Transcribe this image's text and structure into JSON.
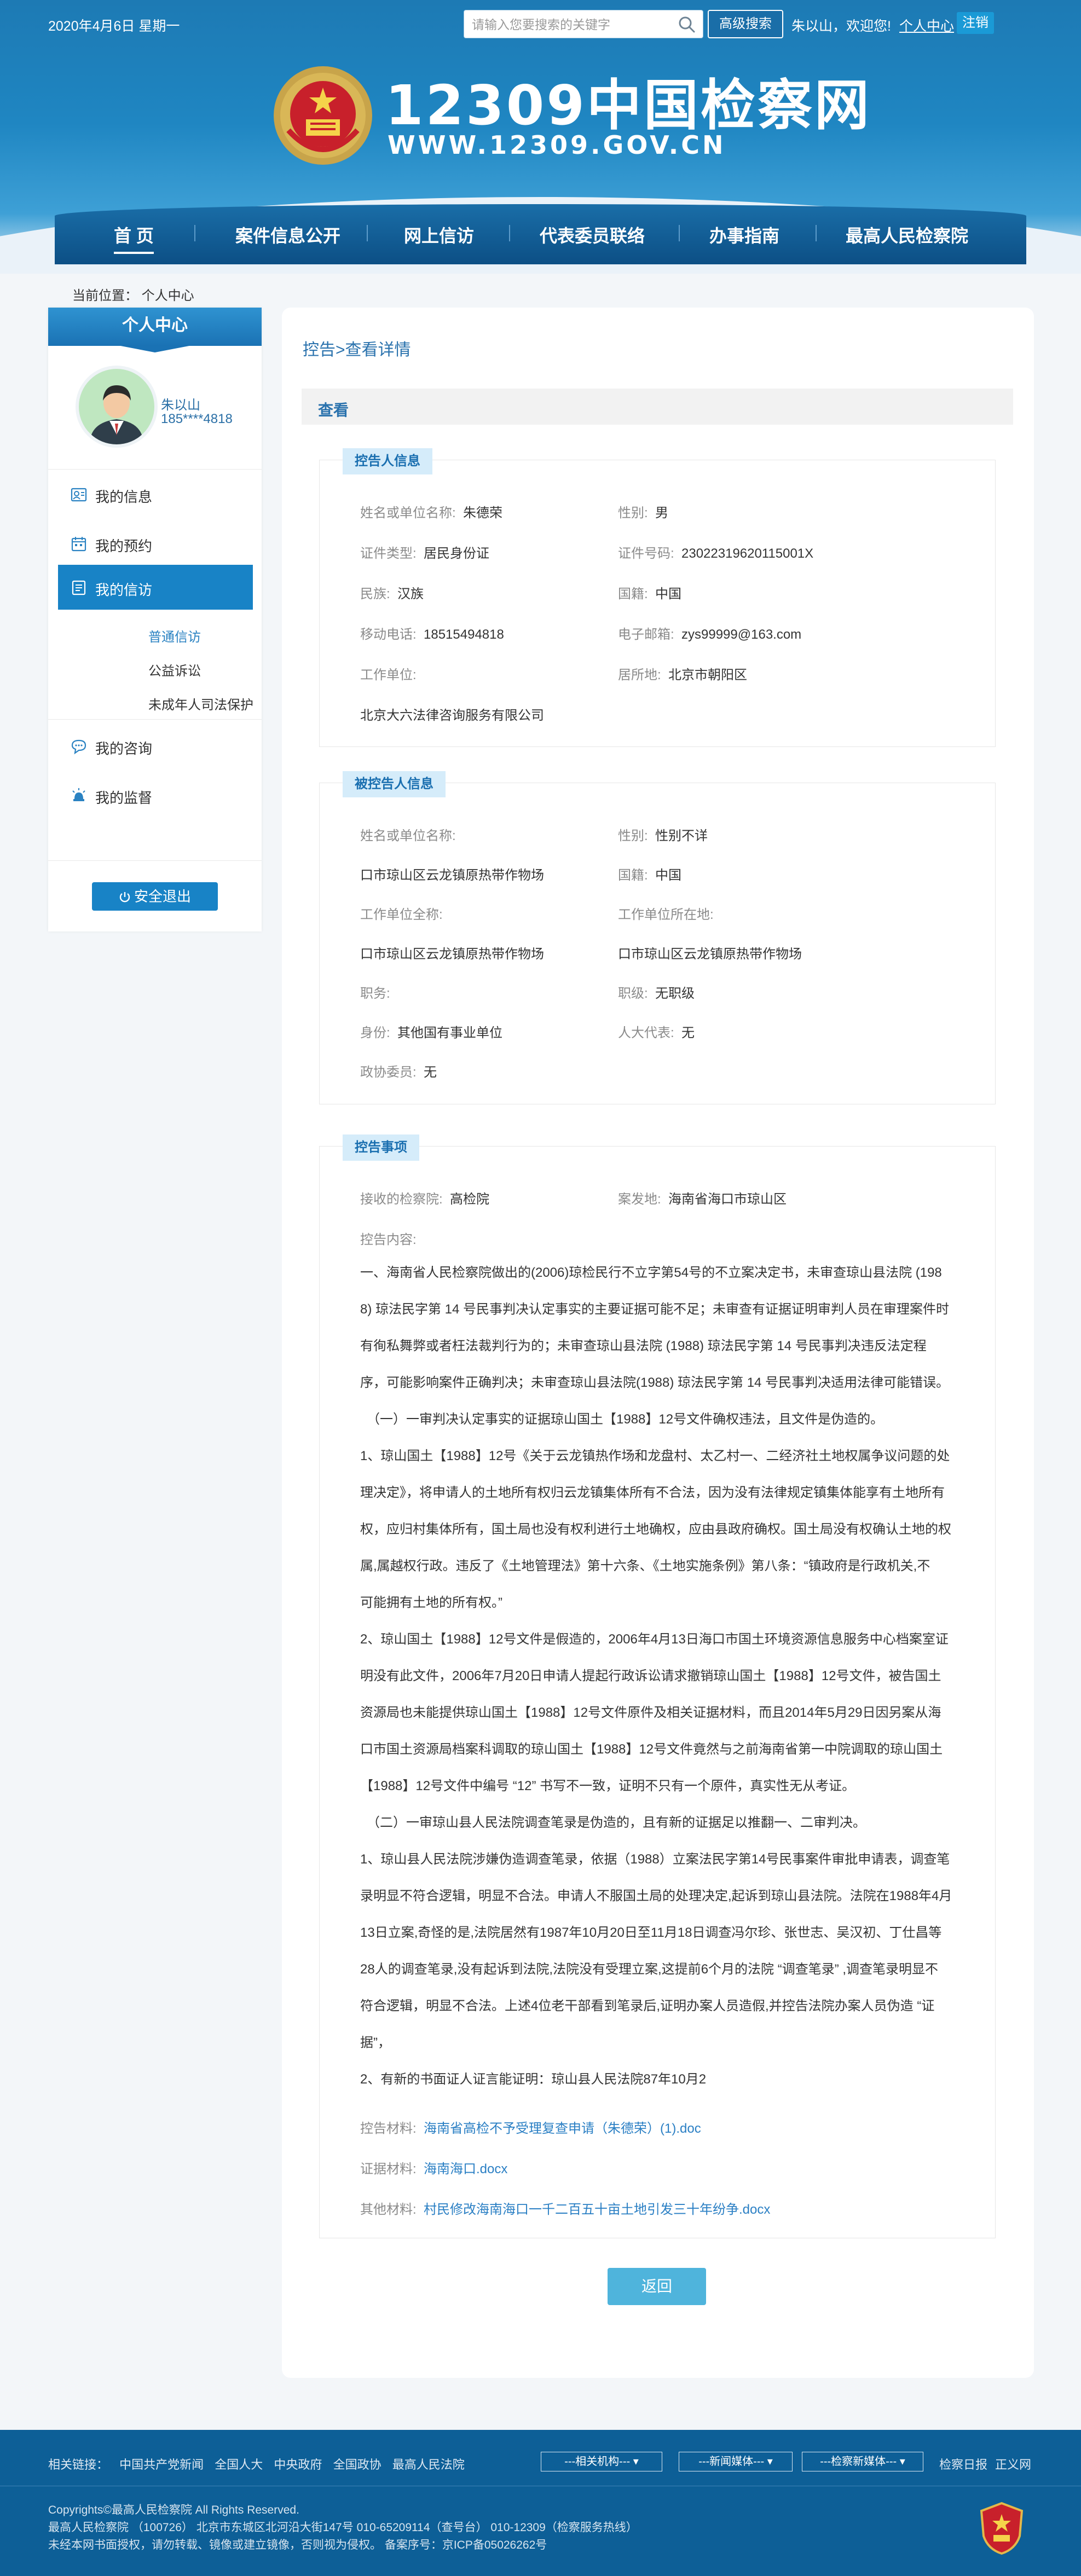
{
  "header": {
    "date": "2020年4月6日 星期一",
    "search_placeholder": "请输入您要搜索的关键字",
    "adv_search": "高级搜索",
    "welcome": "朱以山，欢迎您!",
    "personal_center": "个人中心",
    "logout": "注销",
    "site_title": "12309中国检察网",
    "site_url": "WWW.12309.GOV.CN"
  },
  "nav": {
    "items": [
      "首 页",
      "案件信息公开",
      "网上信访",
      "代表委员联络",
      "办事指南",
      "最高人民检察院"
    ]
  },
  "breadcrumb": "当前位置： 个人中心",
  "sidebar": {
    "title": "个人中心",
    "user_name": "朱以山",
    "user_phone": "185****4818",
    "items": {
      "my_info": "我的信息",
      "my_booking": "我的预约",
      "my_petition": "我的信访",
      "my_consult": "我的咨询",
      "my_supervision": "我的监督"
    },
    "sub_items": [
      "普通信访",
      "公益诉讼",
      "未成年人司法保护"
    ],
    "safe_exit": "安全退出"
  },
  "main": {
    "crumb": "控告>查看详情",
    "view_label": "查看",
    "complainant": {
      "tag": "控告人信息",
      "name_k": "姓名或单位名称:",
      "name_v": "朱德荣",
      "gender_k": "性别:",
      "gender_v": "男",
      "idtype_k": "证件类型:",
      "idtype_v": "居民身份证",
      "idno_k": "证件号码:",
      "idno_v": "23022319620115001X",
      "ethnic_k": "民族:",
      "ethnic_v": "汉族",
      "nation_k": "国籍:",
      "nation_v": "中国",
      "mobile_k": "移动电话:",
      "mobile_v": "18515494818",
      "email_k": "电子邮箱:",
      "email_v": "zys99999@163.com",
      "work_k": "工作单位:",
      "address_k": "居所地:",
      "address_v": "北京市朝阳区",
      "work_v": "北京大六法律咨询服务有限公司"
    },
    "accused": {
      "tag": "被控告人信息",
      "name_k": "姓名或单位名称:",
      "gender_k": "性别:",
      "gender_v": "性别不详",
      "name_v": "口市琼山区云龙镇原热带作物场",
      "nation_k": "国籍:",
      "nation_v": "中国",
      "work_full_k": "工作单位全称:",
      "work_loc_k": "工作单位所在地:",
      "work_full_v": "口市琼山区云龙镇原热带作物场",
      "work_loc_v": "口市琼山区云龙镇原热带作物场",
      "duty_k": "职务:",
      "rank_k": "职级:",
      "rank_v": "无职级",
      "identity_k": "身份:",
      "identity_v": "其他国有事业单位",
      "npc_k": "人大代表:",
      "npc_v": "无",
      "cppcc_k": "政协委员:",
      "cppcc_v": "无"
    },
    "matter": {
      "tag": "控告事项",
      "proc_k": "接收的检察院:",
      "proc_v": "高检院",
      "place_k": "案发地:",
      "place_v": "海南省海口市琼山区",
      "content_k": "控告内容:",
      "lines": [
        "一、海南省人民检察院做出的(2006)琼检民行不立字第54号的不立案决定书，未审查琼山县法院 (198",
        "8) 琼法民字第 14 号民事判决认定事实的主要证据可能不足；未审查有证据证明审判人员在审理案件时",
        "有徇私舞弊或者枉法裁判行为的；未审查琼山县法院 (1988) 琼法民字第 14 号民事判决违反法定程",
        "序，可能影响案件正确判决；未审查琼山县法院(1988) 琼法民字第 14 号民事判决适用法律可能错误。",
        "（一）一审判决认定事实的证据琼山国土【1988】12号文件确权违法，且文件是伪造的。",
        "1、琼山国土【1988】12号《关于云龙镇热作场和龙盘村、太乙村一、二经济社土地权属争议问题的处",
        "理决定》，将申请人的土地所有权归云龙镇集体所有不合法，因为没有法律规定镇集体能享有土地所有",
        "权，应归村集体所有，国土局也没有权利进行土地确权，应由县政府确权。国土局没有权确认土地的权",
        "属,属越权行政。违反了《土地管理法》第十六条、《土地实施条例》第八条：“镇政府是行政机关,不",
        "可能拥有土地的所有权。”",
        "2、琼山国土【1988】12号文件是假造的，2006年4月13日海口市国土环境资源信息服务中心档案室证",
        "明没有此文件，2006年7月20日申请人提起行政诉讼请求撤销琼山国土【1988】12号文件，被告国土",
        "资源局也未能提供琼山国土【1988】12号文件原件及相关证据材料，而且2014年5月29日因另案从海",
        "口市国土资源局档案科调取的琼山国土【1988】12号文件竟然与之前海南省第一中院调取的琼山国土",
        "【1988】12号文件中编号 “12” 书写不一致，证明不只有一个原件，真实性无从考证。",
        "（二）一审琼山县人民法院调查笔录是伪造的，且有新的证据足以推翻一、二审判决。",
        "1、琼山县人民法院涉嫌伪造调查笔录，依据（1988）立案法民字第14号民事案件审批申请表，调查笔",
        "录明显不符合逻辑，明显不合法。申请人不服国土局的处理决定,起诉到琼山县法院。法院在1988年4月",
        "13日立案,奇怪的是,法院居然有1987年10月20日至11月18日调查冯尔珍、张世志、吴汉初、丁仕昌等",
        "28人的调查笔录,没有起诉到法院,法院没有受理立案,这提前6个月的法院 “调查笔录” ,调查笔录明显不",
        "符合逻辑，明显不合法。上述4位老干部看到笔录后,证明办案人员造假,并控告法院办案人员伪造 “证",
        "据”，",
        "2、有新的书面证人证言能证明：琼山县人民法院87年10月2"
      ],
      "accuse_file_k": "控告材料:",
      "accuse_file_v": "海南省高检不予受理复查申请（朱德荣）(1).doc",
      "evidence_file_k": "证据材料:",
      "evidence_file_v": "海南海口.docx",
      "other_file_k": "其他材料:",
      "other_file_v": "村民修改海南海口一千二百五十亩土地引发三十年纷争.docx"
    },
    "return": "返回"
  },
  "footer": {
    "links_label": "相关链接：",
    "links": [
      "中国共产党新闻",
      "全国人大",
      "中央政府",
      "全国政协",
      "最高人民法院"
    ],
    "selects": [
      "---相关机构---",
      "---新闻媒体---",
      "---检察新媒体---"
    ],
    "right_links": [
      "检察日报",
      "正义网"
    ],
    "copyright": "Copyrights©最高人民检察院 All Rights Reserved.",
    "address": "最高人民检察院   （100726）  北京市东城区北河沿大街147号 010-65209114（查号台）   010-12309（检察服务热线）",
    "icp": "未经本网书面授权，请勿转载、镜像或建立镜像，否则视为侵权。 备案序号：京ICP备05026262号"
  }
}
